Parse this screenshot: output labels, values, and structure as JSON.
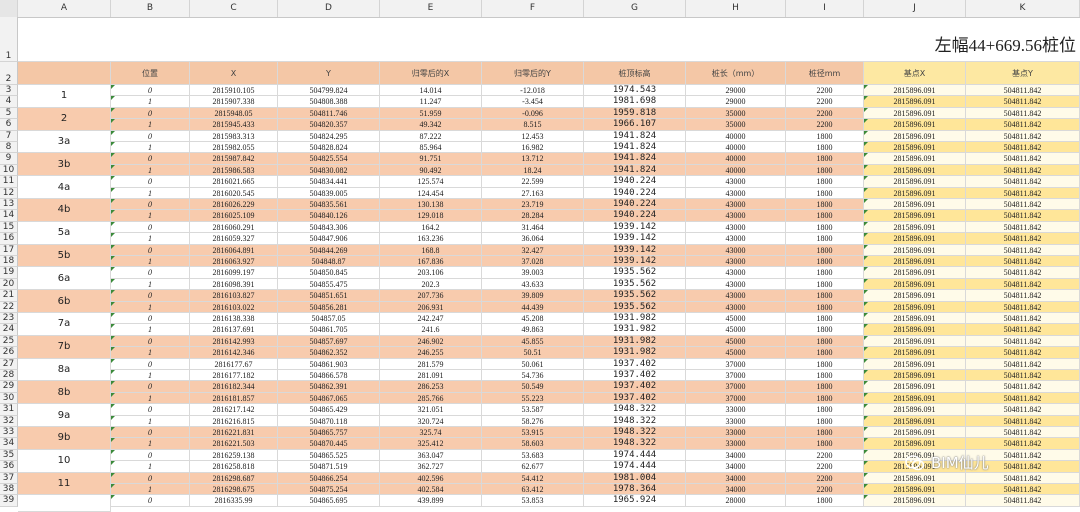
{
  "columns": [
    "A",
    "B",
    "C",
    "D",
    "E",
    "F",
    "G",
    "H",
    "I",
    "J",
    "K"
  ],
  "title": "左幅44+669.56桩位",
  "headers": [
    "位置",
    "X",
    "Y",
    "归零后的X",
    "归零后的Y",
    "桩顶标高",
    "桩长（mm）",
    "桩径mm",
    "基点X",
    "基点Y"
  ],
  "groups": [
    "1",
    "2",
    "3a",
    "3b",
    "4a",
    "4b",
    "5a",
    "5b",
    "6a",
    "6b",
    "7a",
    "7b",
    "8a",
    "8b",
    "9a",
    "9b",
    "10",
    "11"
  ],
  "rows": [
    [
      "0",
      "2815910.105",
      "504799.824",
      "14.014",
      "-12.018",
      "1974.543",
      "29000",
      "2200",
      "2815896.091",
      "504811.842"
    ],
    [
      "1",
      "2815907.338",
      "504808.388",
      "11.247",
      "-3.454",
      "1981.698",
      "29000",
      "2200",
      "2815896.091",
      "504811.842"
    ],
    [
      "0",
      "2815948.05",
      "504811.746",
      "51.959",
      "-0.096",
      "1959.818",
      "35000",
      "2200",
      "2815896.091",
      "504811.842"
    ],
    [
      "1",
      "2815945.433",
      "504820.357",
      "49.342",
      "8.515",
      "1966.107",
      "35000",
      "2200",
      "2815896.091",
      "504811.842"
    ],
    [
      "0",
      "2815983.313",
      "504824.295",
      "87.222",
      "12.453",
      "1941.824",
      "40000",
      "1800",
      "2815896.091",
      "504811.842"
    ],
    [
      "1",
      "2815982.055",
      "504828.824",
      "85.964",
      "16.982",
      "1941.824",
      "40000",
      "1800",
      "2815896.091",
      "504811.842"
    ],
    [
      "0",
      "2815987.842",
      "504825.554",
      "91.751",
      "13.712",
      "1941.824",
      "40000",
      "1800",
      "2815896.091",
      "504811.842"
    ],
    [
      "1",
      "2815986.583",
      "504830.082",
      "90.492",
      "18.24",
      "1941.824",
      "40000",
      "1800",
      "2815896.091",
      "504811.842"
    ],
    [
      "0",
      "2816021.665",
      "504834.441",
      "125.574",
      "22.599",
      "1940.224",
      "43000",
      "1800",
      "2815896.091",
      "504811.842"
    ],
    [
      "1",
      "2816020.545",
      "504839.005",
      "124.454",
      "27.163",
      "1940.224",
      "43000",
      "1800",
      "2815896.091",
      "504811.842"
    ],
    [
      "0",
      "2816026.229",
      "504835.561",
      "130.138",
      "23.719",
      "1940.224",
      "43000",
      "1800",
      "2815896.091",
      "504811.842"
    ],
    [
      "1",
      "2816025.109",
      "504840.126",
      "129.018",
      "28.284",
      "1940.224",
      "43000",
      "1800",
      "2815896.091",
      "504811.842"
    ],
    [
      "0",
      "2816060.291",
      "504843.306",
      "164.2",
      "31.464",
      "1939.142",
      "43000",
      "1800",
      "2815896.091",
      "504811.842"
    ],
    [
      "1",
      "2816059.327",
      "504847.906",
      "163.236",
      "36.064",
      "1939.142",
      "43000",
      "1800",
      "2815896.091",
      "504811.842"
    ],
    [
      "0",
      "2816064.891",
      "504844.269",
      "168.8",
      "32.427",
      "1939.142",
      "43000",
      "1800",
      "2815896.091",
      "504811.842"
    ],
    [
      "1",
      "2816063.927",
      "504848.87",
      "167.836",
      "37.028",
      "1939.142",
      "43000",
      "1800",
      "2815896.091",
      "504811.842"
    ],
    [
      "0",
      "2816099.197",
      "504850.845",
      "203.106",
      "39.003",
      "1935.562",
      "43000",
      "1800",
      "2815896.091",
      "504811.842"
    ],
    [
      "1",
      "2816098.391",
      "504855.475",
      "202.3",
      "43.633",
      "1935.562",
      "43000",
      "1800",
      "2815896.091",
      "504811.842"
    ],
    [
      "0",
      "2816103.827",
      "504851.651",
      "207.736",
      "39.809",
      "1935.562",
      "43000",
      "1800",
      "2815896.091",
      "504811.842"
    ],
    [
      "1",
      "2816103.022",
      "504856.281",
      "206.931",
      "44.439",
      "1935.562",
      "43000",
      "1800",
      "2815896.091",
      "504811.842"
    ],
    [
      "0",
      "2816138.338",
      "504857.05",
      "242.247",
      "45.208",
      "1931.982",
      "45000",
      "1800",
      "2815896.091",
      "504811.842"
    ],
    [
      "1",
      "2816137.691",
      "504861.705",
      "241.6",
      "49.863",
      "1931.982",
      "45000",
      "1800",
      "2815896.091",
      "504811.842"
    ],
    [
      "0",
      "2816142.993",
      "504857.697",
      "246.902",
      "45.855",
      "1931.982",
      "45000",
      "1800",
      "2815896.091",
      "504811.842"
    ],
    [
      "1",
      "2816142.346",
      "504862.352",
      "246.255",
      "50.51",
      "1931.982",
      "45000",
      "1800",
      "2815896.091",
      "504811.842"
    ],
    [
      "0",
      "2816177.67",
      "504861.903",
      "281.579",
      "50.061",
      "1937.402",
      "37000",
      "1800",
      "2815896.091",
      "504811.842"
    ],
    [
      "1",
      "2816177.182",
      "504866.578",
      "281.091",
      "54.736",
      "1937.402",
      "37000",
      "1800",
      "2815896.091",
      "504811.842"
    ],
    [
      "0",
      "2816182.344",
      "504862.391",
      "286.253",
      "50.549",
      "1937.402",
      "37000",
      "1800",
      "2815896.091",
      "504811.842"
    ],
    [
      "1",
      "2816181.857",
      "504867.065",
      "285.766",
      "55.223",
      "1937.402",
      "37000",
      "1800",
      "2815896.091",
      "504811.842"
    ],
    [
      "0",
      "2816217.142",
      "504865.429",
      "321.051",
      "53.587",
      "1948.322",
      "33000",
      "1800",
      "2815896.091",
      "504811.842"
    ],
    [
      "1",
      "2816216.815",
      "504870.118",
      "320.724",
      "58.276",
      "1948.322",
      "33000",
      "1800",
      "2815896.091",
      "504811.842"
    ],
    [
      "0",
      "2816221.831",
      "504865.757",
      "325.74",
      "53.915",
      "1948.322",
      "33000",
      "1800",
      "2815896.091",
      "504811.842"
    ],
    [
      "1",
      "2816221.503",
      "504870.445",
      "325.412",
      "58.603",
      "1948.322",
      "33000",
      "1800",
      "2815896.091",
      "504811.842"
    ],
    [
      "0",
      "2816259.138",
      "504865.525",
      "363.047",
      "53.683",
      "1974.444",
      "34000",
      "2200",
      "2815896.091",
      "504811.842"
    ],
    [
      "1",
      "2816258.818",
      "504871.519",
      "362.727",
      "62.677",
      "1974.444",
      "34000",
      "2200",
      "2815896.091",
      "504811.842"
    ],
    [
      "0",
      "2816298.687",
      "504866.254",
      "402.596",
      "54.412",
      "1981.004",
      "34000",
      "2200",
      "2815896.091",
      "504811.842"
    ],
    [
      "1",
      "2816298.675",
      "504875.254",
      "402.584",
      "63.412",
      "1978.364",
      "34000",
      "2200",
      "2815896.091",
      "504811.842"
    ],
    [
      "0",
      "2816335.99",
      "504865.695",
      "439.899",
      "53.853",
      "1965.924",
      "28000",
      "1800",
      "2815896.091",
      "504811.842"
    ]
  ],
  "watermark": "BIM仙儿",
  "colors": {
    "peach": "#f8cbad",
    "yellow": "#ffe699",
    "header_peach": "#f4c7a6",
    "header_yellow": "#fde8a2"
  }
}
